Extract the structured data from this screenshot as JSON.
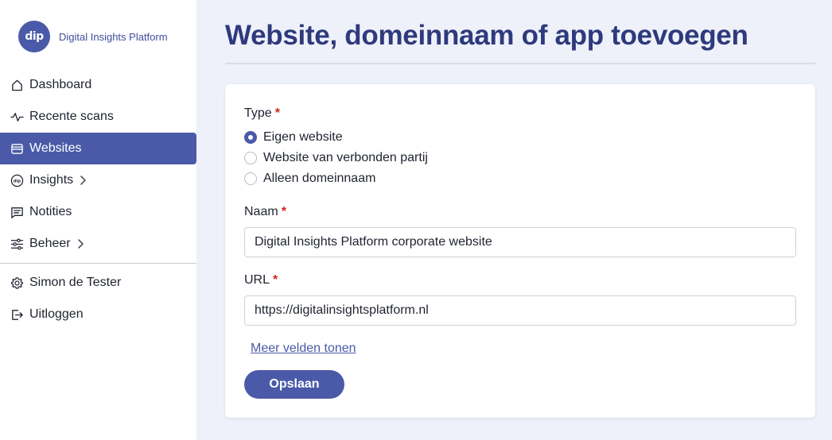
{
  "brand": {
    "logo_text": "dip",
    "name": "Digital Insights Platform"
  },
  "sidebar": {
    "items": [
      {
        "label": "Dashboard",
        "icon": "home-icon"
      },
      {
        "label": "Recente scans",
        "icon": "activity-icon"
      },
      {
        "label": "Websites",
        "icon": "browser-window-icon",
        "active": true
      },
      {
        "label": "Insights",
        "icon": "dip-logo-icon",
        "has_submenu": true
      },
      {
        "label": "Notities",
        "icon": "message-square-icon"
      },
      {
        "label": "Beheer",
        "icon": "sliders-icon",
        "has_submenu": true
      }
    ],
    "user_items": [
      {
        "label": "Simon de Tester",
        "icon": "gear-icon"
      },
      {
        "label": "Uitloggen",
        "icon": "logout-icon"
      }
    ]
  },
  "page": {
    "title": "Website, domeinnaam of app toevoegen"
  },
  "form": {
    "type_label": "Type",
    "required_mark": "*",
    "type_options": [
      {
        "label": "Eigen website",
        "checked": true
      },
      {
        "label": "Website van verbonden partij",
        "checked": false
      },
      {
        "label": "Alleen domeinnaam",
        "checked": false
      }
    ],
    "name_label": "Naam",
    "name_value": "Digital Insights Platform corporate website",
    "url_label": "URL",
    "url_value": "https://digitalinsightsplatform.nl",
    "more_fields_link": "Meer velden tonen",
    "save_label": "Opslaan"
  },
  "colors": {
    "accent": "#4a5aa8",
    "title": "#2e3a7c",
    "required": "#d0241c",
    "background": "#eef1f9"
  }
}
